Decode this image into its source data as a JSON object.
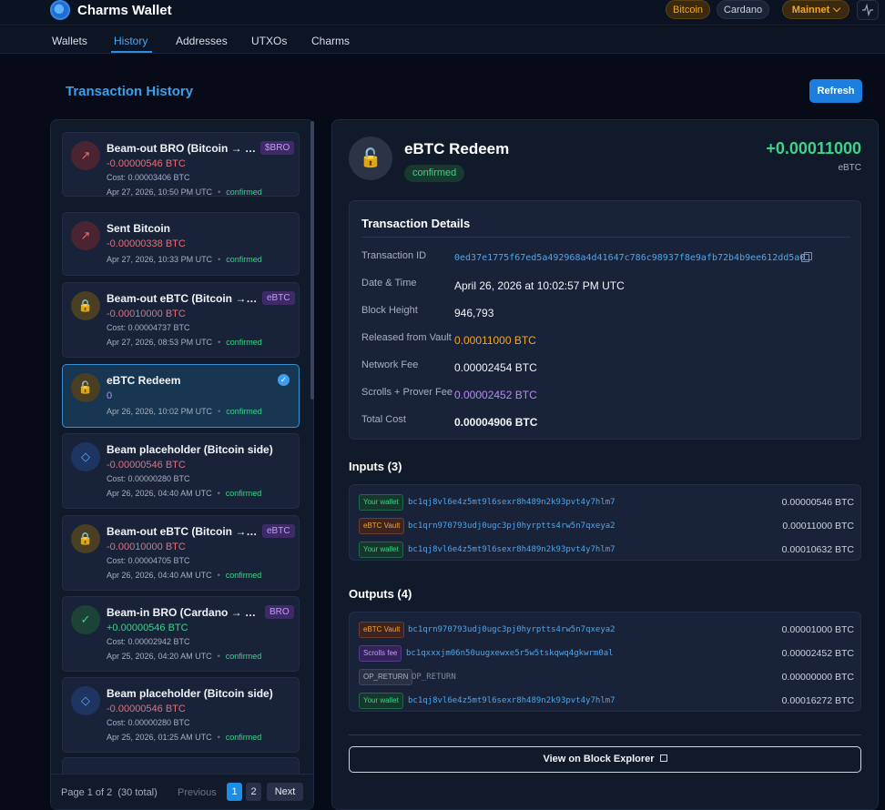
{
  "app": {
    "title": "Charms Wallet",
    "chains": [
      "Bitcoin",
      "Cardano"
    ],
    "network": "Mainnet",
    "accent": "#2b8ee0"
  },
  "nav": [
    "Wallets",
    "History",
    "Addresses",
    "UTXOs",
    "Charms"
  ],
  "page": {
    "title": "Transaction History",
    "refresh": "Refresh"
  },
  "list": [
    {
      "title": "Beam-out BRO (Bitcoin → C...",
      "tag": "$BRO",
      "amount": "-0.00000546 BTC",
      "cost": "Cost: 0.00003406 BTC",
      "date": "Apr 27, 2026, 10:50 PM UTC",
      "status": "confirmed",
      "icon": "arrow-up-right-icon",
      "glyph": "↗"
    },
    {
      "title": "Sent Bitcoin",
      "tag": "",
      "amount": "-0.00000338 BTC",
      "cost": "",
      "date": "Apr 27, 2026, 10:33 PM UTC",
      "status": "confirmed",
      "icon": "arrow-up-right-icon",
      "glyph": "↗"
    },
    {
      "title": "Beam-out eBTC (Bitcoin → C...",
      "tag": "eBTC",
      "amount": "-0.00010000 BTC",
      "cost": "Cost: 0.00004737 BTC",
      "date": "Apr 27, 2026, 08:53 PM UTC",
      "status": "confirmed",
      "icon": "lock-icon",
      "glyph": "🔒"
    },
    {
      "title": "eBTC Redeem",
      "tag": "",
      "amount": "0",
      "cost": "",
      "date": "Apr 26, 2026, 10:02 PM UTC",
      "status": "confirmed",
      "icon": "unlock-icon",
      "glyph": "🔓"
    },
    {
      "title": "Beam placeholder (Bitcoin side)",
      "tag": "",
      "amount": "-0.00000546 BTC",
      "cost": "Cost: 0.00000280 BTC",
      "date": "Apr 26, 2026, 04:40 AM UTC",
      "status": "confirmed",
      "icon": "diamond-icon",
      "glyph": "◇"
    },
    {
      "title": "Beam-out eBTC (Bitcoin → C...",
      "tag": "eBTC",
      "amount": "-0.00010000 BTC",
      "cost": "Cost: 0.00004705 BTC",
      "date": "Apr 26, 2026, 04:40 AM UTC",
      "status": "confirmed",
      "icon": "lock-icon",
      "glyph": "🔒"
    },
    {
      "title": "Beam-in BRO (Cardano → Bit...",
      "tag": "BRO",
      "amount": "+0.00000546 BTC",
      "cost": "Cost: 0.00002942 BTC",
      "date": "Apr 25, 2026, 04:20 AM UTC",
      "status": "confirmed",
      "icon": "checkmark-icon",
      "glyph": "✓"
    },
    {
      "title": "Beam placeholder (Bitcoin side)",
      "tag": "",
      "amount": "-0.00000546 BTC",
      "cost": "Cost: 0.00000280 BTC",
      "date": "Apr 25, 2026, 01:25 AM UTC",
      "status": "confirmed",
      "icon": "diamond-icon",
      "glyph": "◇"
    }
  ],
  "pager": {
    "info": "Page 1 of 2  (30 total)",
    "prev": "Previous",
    "pages": [
      "1",
      "2"
    ],
    "next": "Next"
  },
  "detail": {
    "title": "eBTC Redeem",
    "status": "confirmed",
    "amount": "+0.00011000",
    "unit": "eBTC",
    "box_title": "Transaction Details",
    "rows": [
      {
        "label": "Transaction ID",
        "value": "0ed37e1775f67ed5a492968a4d41647c786c98937f8e9afb72b4b9ee612dd5a0"
      },
      {
        "label": "Date & Time",
        "value": "April 26, 2026 at 10:02:57 PM UTC"
      },
      {
        "label": "Block Height",
        "value": "946,793"
      },
      {
        "label": "Released from Vault",
        "value": "0.00011000 BTC"
      },
      {
        "label": "Network Fee",
        "value": "0.00002454 BTC"
      },
      {
        "label": "Scrolls + Prover Fee",
        "value": "0.00002452 BTC"
      },
      {
        "label": "Total Cost",
        "value": "0.00004906 BTC"
      }
    ],
    "inputs_title": "Inputs (3)",
    "inputs": [
      {
        "tag": "Your wallet",
        "addr": "bc1qj8vl6e4z5mt9l6sexr8h489n2k93pvt4y7hlm7",
        "value": "0.00000546 BTC"
      },
      {
        "tag": "eBTC Vault",
        "addr": "bc1qrn970793udj0ugc3pj0hyrptts4rw5n7qxeya2",
        "value": "0.00011000 BTC"
      },
      {
        "tag": "Your wallet",
        "addr": "bc1qj8vl6e4z5mt9l6sexr8h489n2k93pvt4y7hlm7",
        "value": "0.00010632 BTC"
      }
    ],
    "outputs_title": "Outputs (4)",
    "outputs": [
      {
        "tag": "eBTC Vault",
        "addr": "bc1qrn970793udj0ugc3pj0hyrptts4rw5n7qxeya2",
        "value": "0.00001000 BTC"
      },
      {
        "tag": "Scrolls fee",
        "addr": "bc1qxxxjm06n50uugxewxe5r5w5tskqwq4gkwrm0al",
        "value": "0.00002452 BTC"
      },
      {
        "tag": "OP_RETURN",
        "addr": "OP_RETURN",
        "value": "0.00000000 BTC"
      },
      {
        "tag": "Your wallet",
        "addr": "bc1qj8vl6e4z5mt9l6sexr8h489n2k93pvt4y7hlm7",
        "value": "0.00016272 BTC"
      }
    ],
    "explorer": "View on Block Explorer"
  }
}
